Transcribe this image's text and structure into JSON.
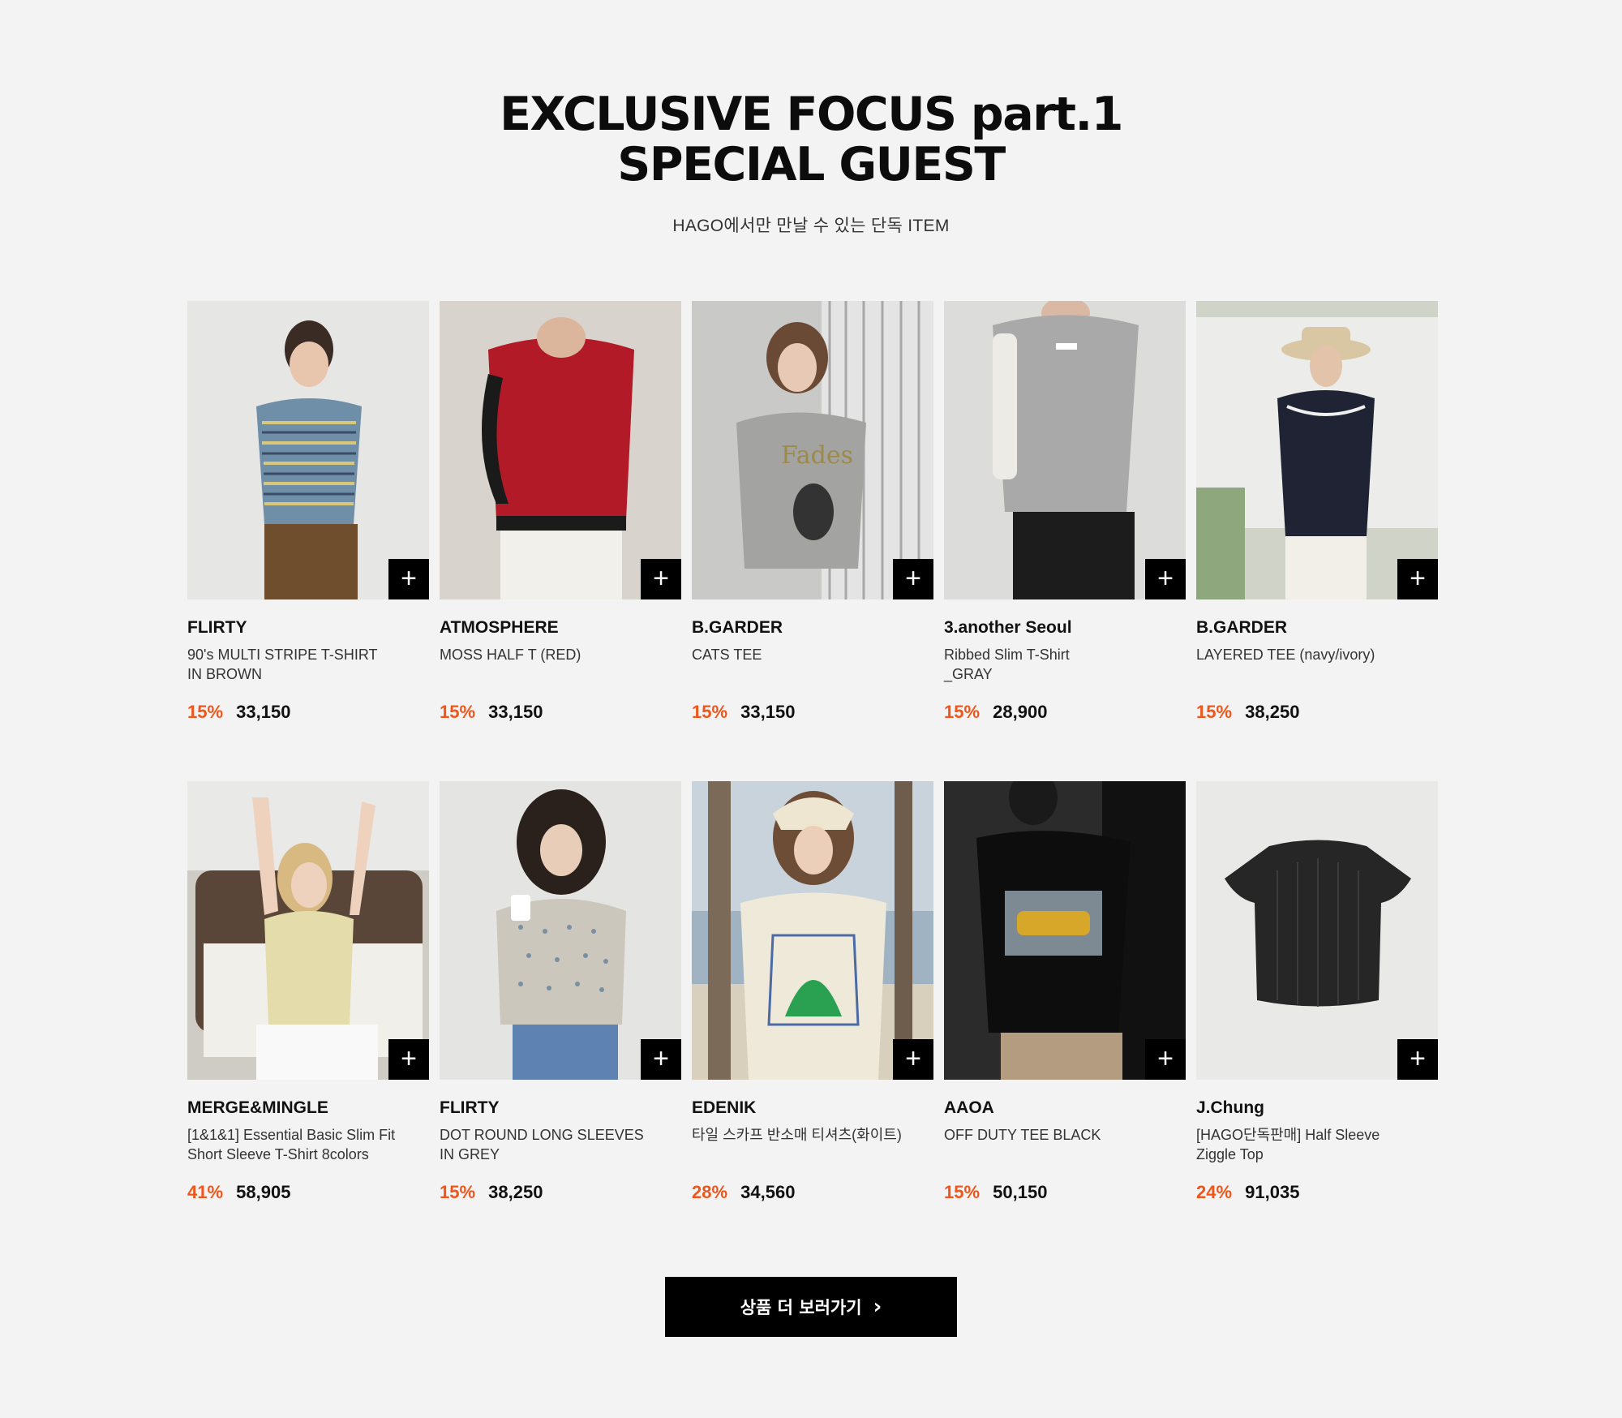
{
  "header": {
    "title_line1": "EXCLUSIVE FOCUS part.1",
    "title_line2": "SPECIAL GUEST",
    "subtitle": "HAGO에서만 만날 수 있는 단독 ITEM"
  },
  "products": [
    {
      "brand": "FLIRTY",
      "name_line1": "90's MULTI STRIPE T-SHIRT",
      "name_line2": "IN BROWN",
      "discount": "15%",
      "price": "33,150"
    },
    {
      "brand": "ATMOSPHERE",
      "name_line1": "MOSS HALF T (RED)",
      "name_line2": "",
      "discount": "15%",
      "price": "33,150"
    },
    {
      "brand": "B.GARDER",
      "name_line1": "CATS TEE",
      "name_line2": "",
      "discount": "15%",
      "price": "33,150"
    },
    {
      "brand": "3.another Seoul",
      "name_line1": "Ribbed Slim T-Shirt",
      "name_line2": "_GRAY",
      "discount": "15%",
      "price": "28,900"
    },
    {
      "brand": "B.GARDER",
      "name_line1": "LAYERED TEE (navy/ivory)",
      "name_line2": "",
      "discount": "15%",
      "price": "38,250"
    },
    {
      "brand": "MERGE&MINGLE",
      "name_line1": "[1&1&1] Essential Basic Slim Fit",
      "name_line2": "Short Sleeve T-Shirt 8colors",
      "discount": "41%",
      "price": "58,905"
    },
    {
      "brand": "FLIRTY",
      "name_line1": "DOT ROUND LONG SLEEVES",
      "name_line2": "IN GREY",
      "discount": "15%",
      "price": "38,250"
    },
    {
      "brand": "EDENIK",
      "name_line1": "타일 스카프 반소매 티셔츠(화이트)",
      "name_line2": "",
      "discount": "28%",
      "price": "34,560"
    },
    {
      "brand": "AAOA",
      "name_line1": "OFF DUTY TEE BLACK",
      "name_line2": "",
      "discount": "15%",
      "price": "50,150"
    },
    {
      "brand": "J.Chung",
      "name_line1": "[HAGO단독판매] Half Sleeve",
      "name_line2": "Ziggle Top",
      "discount": "24%",
      "price": "91,035"
    }
  ],
  "add_button_icon": "plus-icon",
  "more_button": {
    "label": "상품 더 보러가기",
    "icon": "chevron-right-icon"
  },
  "colors": {
    "accent": "#f0561b",
    "background": "#f4f3f3",
    "button": "#000000"
  }
}
